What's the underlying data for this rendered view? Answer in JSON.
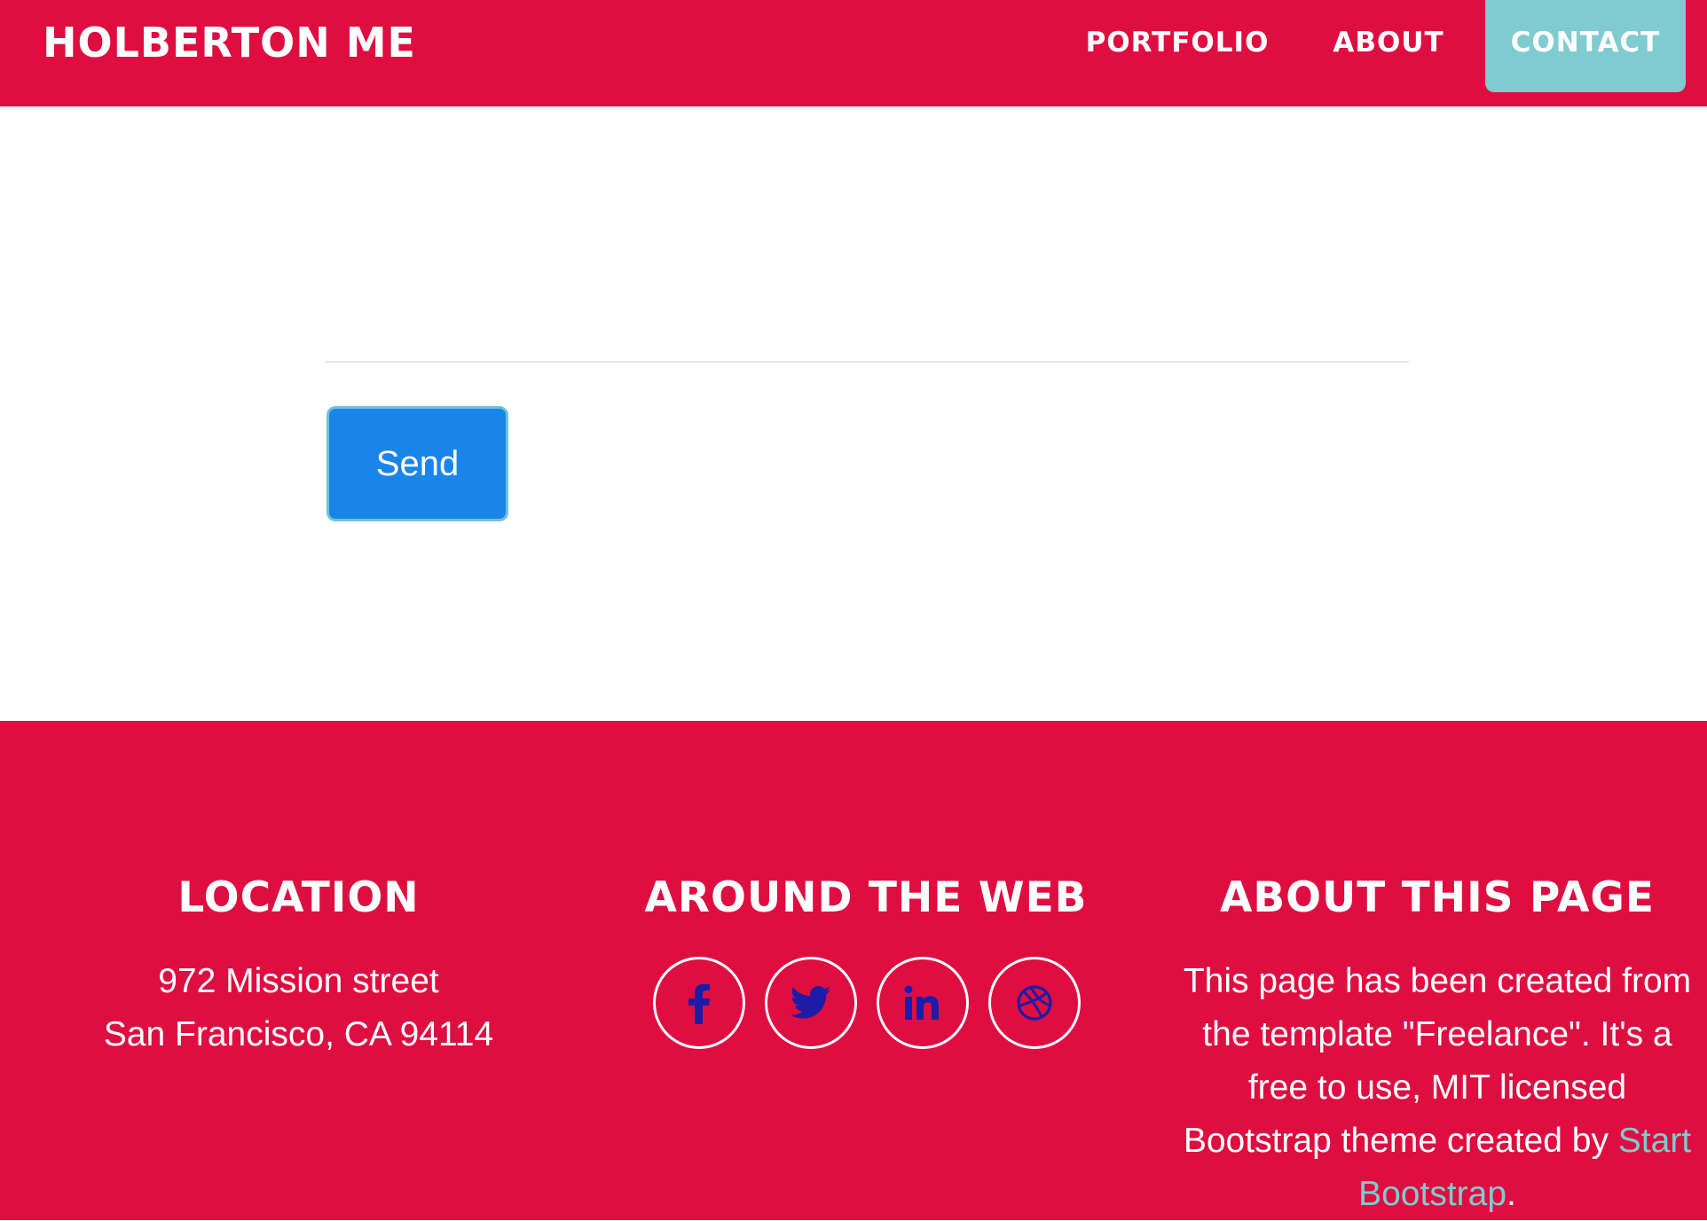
{
  "navbar": {
    "brand": "HOLBERTON ME",
    "items": [
      {
        "label": "PORTFOLIO"
      },
      {
        "label": "ABOUT"
      },
      {
        "label": "CONTACT",
        "active": true
      }
    ],
    "background_color": "#df0e40",
    "active_color": "#7ecbd0"
  },
  "form": {
    "send_label": "Send",
    "send_color": "#1a85e8"
  },
  "footer": {
    "location": {
      "heading": "LOCATION",
      "line1": "972 Mission street",
      "line2": "San Francisco, CA 94114"
    },
    "web": {
      "heading": "AROUND THE WEB",
      "icons": [
        "facebook-icon",
        "twitter-icon",
        "linkedin-icon",
        "dribbble-icon"
      ],
      "icon_color": "#1c1ca8"
    },
    "about": {
      "heading": "ABOUT THIS PAGE",
      "text_before_link": "This page has been created from the template \"Freelance\". It's a free to use, MIT licensed Bootstrap theme created by ",
      "link_text": "Start Bootstrap",
      "text_after_link": "."
    }
  }
}
